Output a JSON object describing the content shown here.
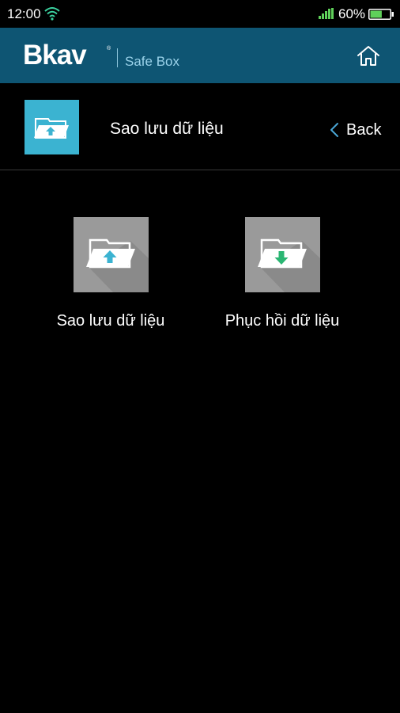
{
  "status_bar": {
    "time": "12:00",
    "battery_percent": "60%",
    "battery_level": 0.6,
    "icons": [
      "wifi-icon",
      "signal-icon",
      "battery-icon"
    ]
  },
  "header": {
    "brand": "Bkav",
    "brand_mark": "®",
    "product": "Safe Box",
    "background_color": "#0e5573",
    "home_icon": "home-icon"
  },
  "title_row": {
    "title": "Sao lưu dữ liệu",
    "back_label": "Back",
    "icon": "folder-backup-icon",
    "icon_color": "#3bb3d1"
  },
  "actions": [
    {
      "label": "Sao lưu dữ liệu",
      "icon": "folder-upload-icon",
      "arrow_color": "#3bb3d1"
    },
    {
      "label": "Phục hồi dữ liệu",
      "icon": "folder-download-icon",
      "arrow_color": "#2bb673"
    }
  ]
}
